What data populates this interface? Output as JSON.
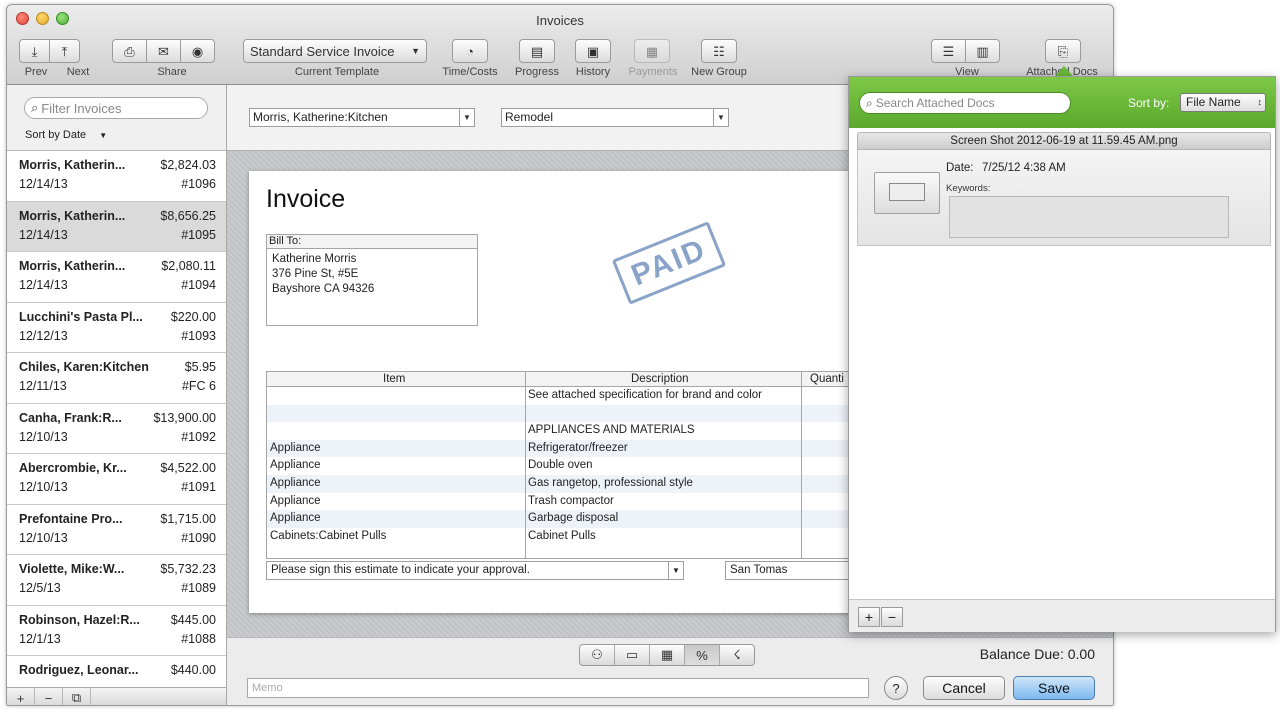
{
  "window": {
    "title": "Invoices"
  },
  "toolbar": {
    "prev": "Prev",
    "next": "Next",
    "share": "Share",
    "template_value": "Standard Service Invoice",
    "template_label": "Current Template",
    "time_costs": "Time/Costs",
    "progress": "Progress",
    "history": "History",
    "payments": "Payments",
    "new_group": "New Group",
    "view": "View",
    "attached_docs": "Attached Docs"
  },
  "sidebar": {
    "filter_placeholder": "Filter Invoices",
    "sort_label": "Sort by Date",
    "items": [
      {
        "name": "Morris, Katherin...",
        "amount": "$2,824.03",
        "date": "12/14/13",
        "number": "#1096"
      },
      {
        "name": "Morris, Katherin...",
        "amount": "$8,656.25",
        "date": "12/14/13",
        "number": "#1095"
      },
      {
        "name": "Morris, Katherin...",
        "amount": "$2,080.11",
        "date": "12/14/13",
        "number": "#1094"
      },
      {
        "name": "Lucchini's Pasta Pl...",
        "amount": "$220.00",
        "date": "12/12/13",
        "number": "#1093"
      },
      {
        "name": "Chiles, Karen:Kitchen",
        "amount": "$5.95",
        "date": "12/11/13",
        "number": "#FC 6"
      },
      {
        "name": "Canha, Frank:R...",
        "amount": "$13,900.00",
        "date": "12/10/13",
        "number": "#1092"
      },
      {
        "name": "Abercrombie, Kr...",
        "amount": "$4,522.00",
        "date": "12/10/13",
        "number": "#1091"
      },
      {
        "name": "Prefontaine Pro...",
        "amount": "$1,715.00",
        "date": "12/10/13",
        "number": "#1090"
      },
      {
        "name": "Violette, Mike:W...",
        "amount": "$5,732.23",
        "date": "12/5/13",
        "number": "#1089"
      },
      {
        "name": "Robinson, Hazel:R...",
        "amount": "$445.00",
        "date": "12/1/13",
        "number": "#1088"
      },
      {
        "name": "Rodriguez, Leonar...",
        "amount": "$440.00",
        "date": "",
        "number": ""
      }
    ]
  },
  "invoice": {
    "customer": "Morris, Katherine:Kitchen",
    "class": "Remodel",
    "title": "Invoice",
    "bill_to_label": "Bill To:",
    "bill_to_lines": [
      "Katherine Morris",
      "376 Pine St, #5E",
      "Bayshore CA 94326"
    ],
    "stamp": "PAID",
    "columns": {
      "item": "Item",
      "description": "Description",
      "quantity": "Quanti"
    },
    "rows": [
      {
        "item": "",
        "description": "See attached specification for brand and color"
      },
      {
        "item": "",
        "description": ""
      },
      {
        "item": "",
        "description": "APPLIANCES AND MATERIALS"
      },
      {
        "item": "Appliance",
        "description": "Refrigerator/freezer"
      },
      {
        "item": "Appliance",
        "description": "Double oven"
      },
      {
        "item": "Appliance",
        "description": "Gas rangetop, professional style"
      },
      {
        "item": "Appliance",
        "description": "Trash compactor"
      },
      {
        "item": "Appliance",
        "description": "Garbage disposal"
      },
      {
        "item": "Cabinets:Cabinet Pulls",
        "description": "Cabinet Pulls"
      }
    ],
    "customer_message": "Please sign this estimate to indicate your approval.",
    "location": "San Tomas"
  },
  "footer": {
    "balance_due": "Balance Due: 0.00",
    "memo_placeholder": "Memo",
    "help": "?",
    "cancel": "Cancel",
    "save": "Save"
  },
  "attached_docs": {
    "search_placeholder": "Search Attached Docs",
    "sort_label": "Sort by:",
    "sort_value": "File Name",
    "doc": {
      "filename": "Screen Shot 2012-06-19 at 11.59.45 AM.png",
      "date_label": "Date:",
      "date_value": "7/25/12 4:38 AM",
      "keywords_label": "Keywords:"
    },
    "add": "+",
    "remove": "−"
  },
  "colors": {
    "popover_green": "#6bb83a",
    "save_blue": "#7db8ef",
    "paid_stamp": "#8aa3c9"
  }
}
